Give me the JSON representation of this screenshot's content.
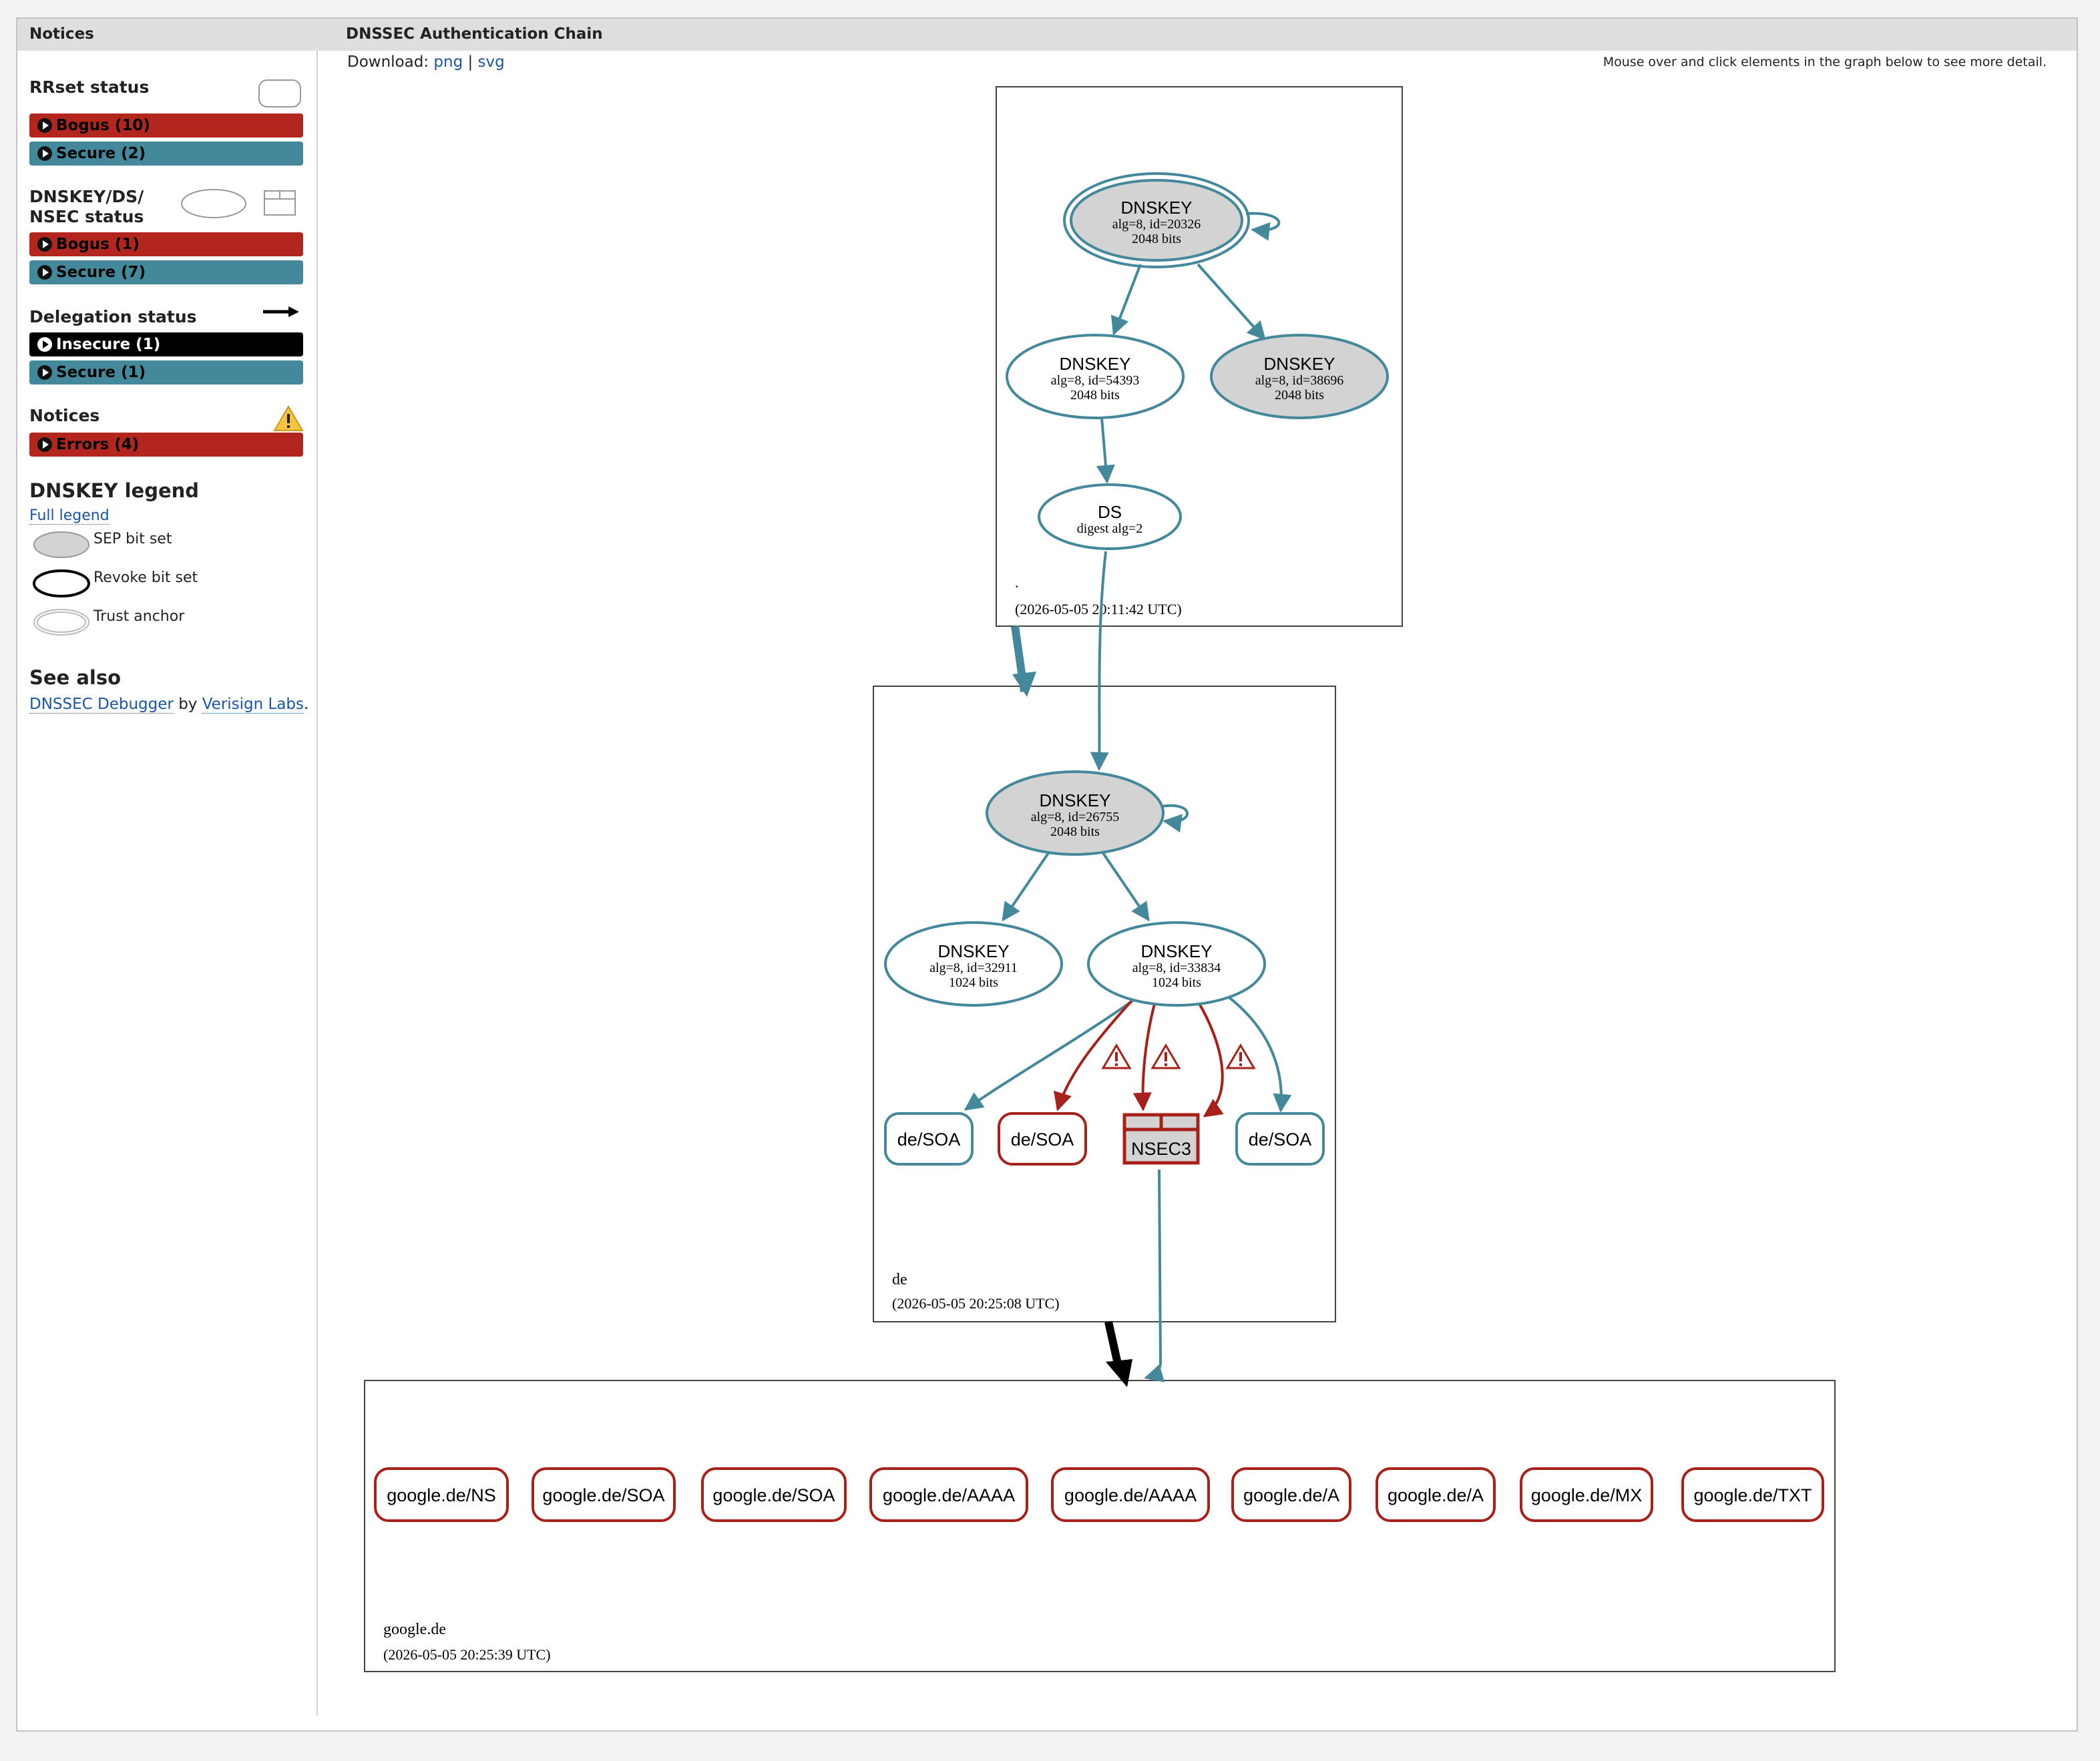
{
  "header": {
    "left_title": "Notices",
    "main_title": "DNSSEC Authentication Chain"
  },
  "download": {
    "label": "Download:",
    "png": "png",
    "sep": "|",
    "svg": "svg"
  },
  "hint": "Mouse over and click elements in the graph below to see more detail.",
  "sidebar": {
    "rrset": {
      "title": "RRset status",
      "bogus": "Bogus (10)",
      "secure": "Secure (2)"
    },
    "dnskey": {
      "title_line1": "DNSKEY/DS/",
      "title_line2": "NSEC status",
      "bogus": "Bogus (1)",
      "secure": "Secure (7)"
    },
    "delegation": {
      "title": "Delegation status",
      "insecure": "Insecure (1)",
      "secure": "Secure (1)"
    },
    "notices": {
      "title": "Notices",
      "errors": "Errors (4)"
    },
    "legend": {
      "title": "DNSKEY legend",
      "full_link": "Full legend",
      "sep": "SEP bit set",
      "revoke": "Revoke bit set",
      "trust": "Trust anchor"
    },
    "see_also": {
      "title": "See also",
      "debugger": "DNSSEC Debugger",
      "by": "by",
      "labs": "Verisign Labs",
      "period": "."
    }
  },
  "colors": {
    "bogus": "#b2261e",
    "secure": "#44899b",
    "insecure": "#000000",
    "sep_fill": "#d3d3d3"
  },
  "graph": {
    "root": {
      "label": ".",
      "time": "(2026-05-05 20:11:42 UTC)",
      "ksk": {
        "title": "DNSKEY",
        "alg": "alg=8, id=20326",
        "bits": "2048 bits"
      },
      "zsk": {
        "title": "DNSKEY",
        "alg": "alg=8, id=54393",
        "bits": "2048 bits"
      },
      "k3": {
        "title": "DNSKEY",
        "alg": "alg=8, id=38696",
        "bits": "2048 bits"
      },
      "ds": {
        "title": "DS",
        "detail": "digest alg=2"
      }
    },
    "de": {
      "label": "de",
      "time": "(2026-05-05 20:25:08 UTC)",
      "ksk": {
        "title": "DNSKEY",
        "alg": "alg=8, id=26755",
        "bits": "2048 bits"
      },
      "zsk1": {
        "title": "DNSKEY",
        "alg": "alg=8, id=32911",
        "bits": "1024 bits"
      },
      "zsk2": {
        "title": "DNSKEY",
        "alg": "alg=8, id=33834",
        "bits": "1024 bits"
      },
      "soa1": "de/SOA",
      "soa2": "de/SOA",
      "nsec3": "NSEC3",
      "soa3": "de/SOA"
    },
    "google": {
      "label": "google.de",
      "time": "(2026-05-05 20:25:39 UTC)",
      "rrsets": [
        "google.de/NS",
        "google.de/SOA",
        "google.de/SOA",
        "google.de/AAAA",
        "google.de/AAAA",
        "google.de/A",
        "google.de/A",
        "google.de/MX",
        "google.de/TXT"
      ]
    }
  }
}
